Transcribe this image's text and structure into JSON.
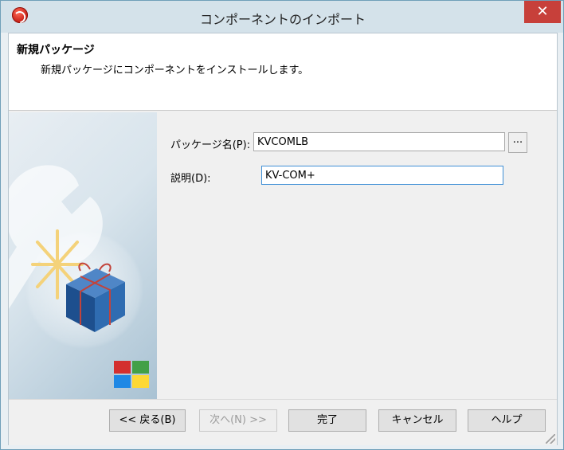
{
  "window": {
    "title": "コンポーネントのインポート",
    "close_glyph": "✕"
  },
  "header": {
    "title": "新規パッケージ",
    "description": "新規パッケージにコンポーネントをインストールします。"
  },
  "form": {
    "package_name_label": "パッケージ名(P):",
    "package_name_value": "KVCOMLB",
    "browse_label": "...",
    "description_label": "説明(D):",
    "description_value": "KV-COM+"
  },
  "buttons": {
    "back": "<< 戻る(B)",
    "next": "次へ(N) >>",
    "finish": "完了",
    "cancel": "キャンセル",
    "help": "ヘルプ"
  },
  "colors": {
    "accent": "#3f8fd6",
    "close": "#c7403a"
  },
  "icons": {
    "app": "app-icon",
    "close": "close-icon"
  }
}
